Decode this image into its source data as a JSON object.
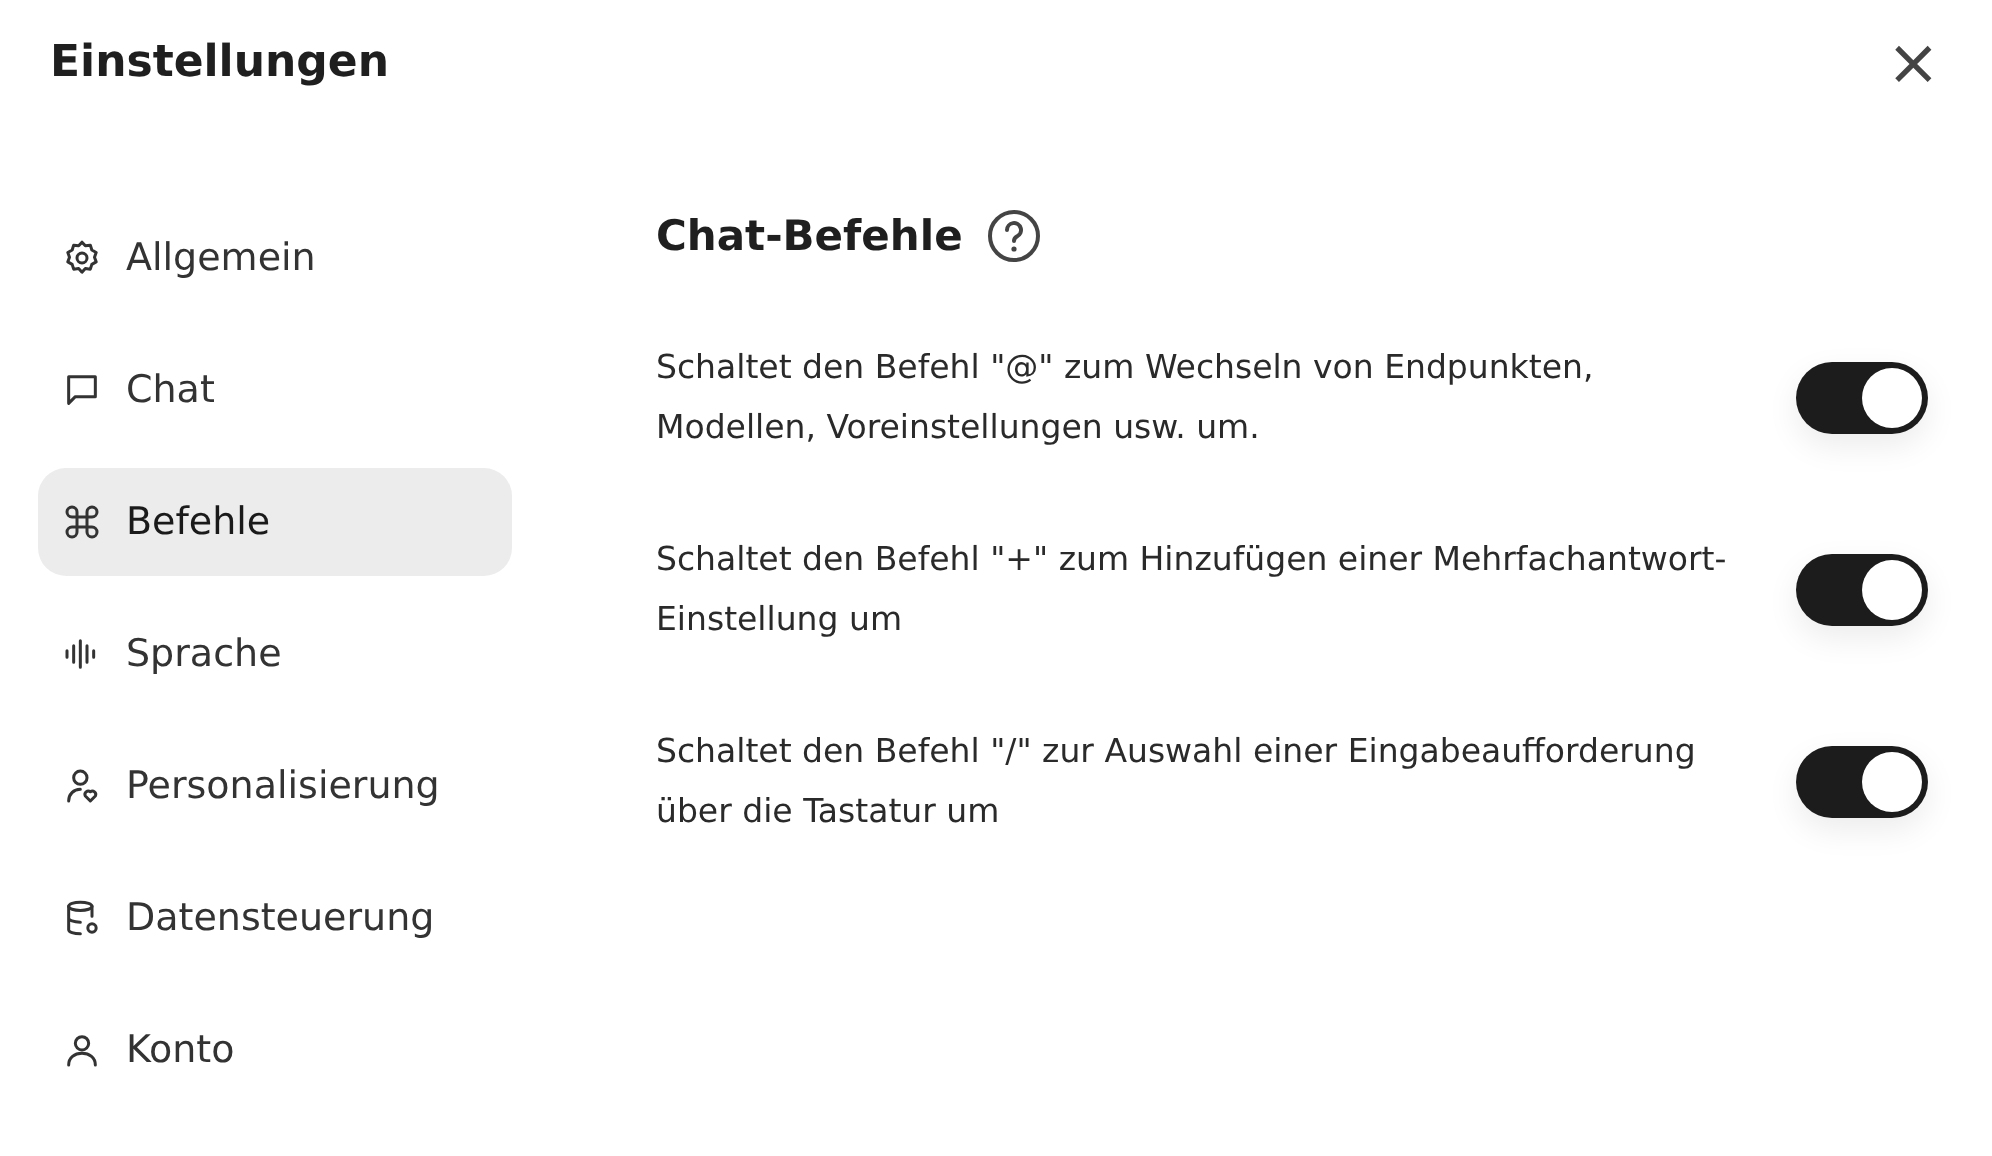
{
  "dialog": {
    "title": "Einstellungen",
    "close": "×"
  },
  "sidebar": {
    "items": [
      {
        "label": "Allgemein",
        "selected": false
      },
      {
        "label": "Chat",
        "selected": false
      },
      {
        "label": "Befehle",
        "selected": true
      },
      {
        "label": "Sprache",
        "selected": false
      },
      {
        "label": "Personalisierung",
        "selected": false
      },
      {
        "label": "Datensteuerung",
        "selected": false
      },
      {
        "label": "Konto",
        "selected": false
      }
    ]
  },
  "section": {
    "title": "Chat-Befehle",
    "settings": [
      {
        "description": "Schaltet den Befehl \"@\" zum Wechseln von Endpunkten, Modellen, Voreinstellungen usw. um.",
        "on": true
      },
      {
        "description": "Schaltet den Befehl \"+\" zum Hinzufügen einer Mehrfachantwort-Einstellung um",
        "on": true
      },
      {
        "description": "Schaltet den Befehl \"/\" zur Auswahl einer Eingabeaufforderung über die Tastatur um",
        "on": true
      }
    ]
  }
}
